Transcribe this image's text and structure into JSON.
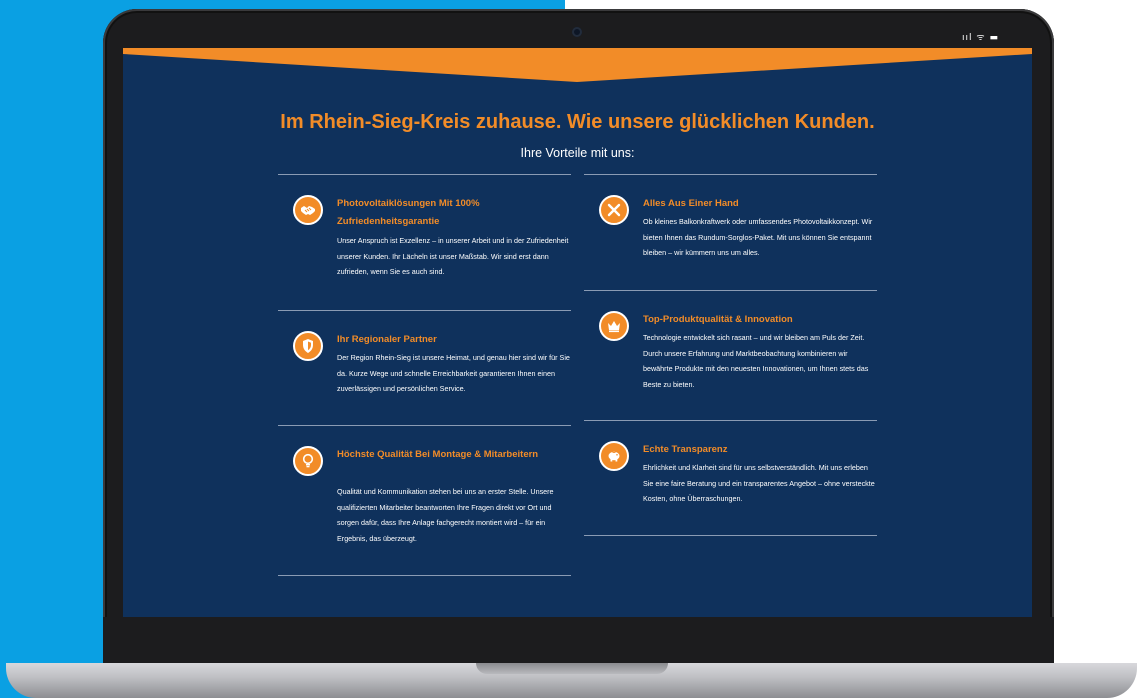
{
  "status_bar": {
    "indicators": "ııl ᯤ ▬"
  },
  "header": {
    "title": "Im Rhein-Sieg-Kreis zuhause. Wie unsere glücklichen Kunden.",
    "subtitle": "Ihre Vorteile mit uns:"
  },
  "colors": {
    "accent": "#f28c28",
    "background": "#0f315c",
    "text": "#ffffff"
  },
  "features_left": [
    {
      "icon": "handshake-icon",
      "title": "Photovoltaiklösungen Mit 100% Zufriedenheitsgarantie",
      "text": "Unser Anspruch ist Exzellenz – in unserer Arbeit und in der Zufriedenheit unserer Kunden. Ihr Lächeln ist unser Maßstab. Wir sind erst dann zufrieden, wenn Sie es auch sind."
    },
    {
      "icon": "shield-icon",
      "title": "Ihr Regionaler Partner",
      "text": "Der Region Rhein-Sieg ist unsere Heimat, und genau hier sind wir für Sie da. Kurze Wege und schnelle Erreichbarkeit garantieren Ihnen einen zuverlässigen und persönlichen Service."
    },
    {
      "icon": "lightbulb-icon",
      "title": "Höchste Qualität Bei Montage & Mitarbeitern",
      "text": "Qualität und Kommunikation stehen bei uns an erster Stelle. Unsere qualifizierten Mitarbeiter beantworten Ihre Fragen direkt vor Ort und sorgen dafür, dass Ihre Anlage fachgerecht montiert wird – für ein Ergebnis, das überzeugt."
    }
  ],
  "features_right": [
    {
      "icon": "tools-icon",
      "title": "Alles Aus Einer Hand",
      "text": "Ob kleines Balkonkraftwerk oder umfassendes Photovoltaikkonzept. Wir bieten Ihnen das Rundum-Sorglos-Paket. Mit uns können Sie entspannt bleiben – wir kümmern uns um alles."
    },
    {
      "icon": "crown-icon",
      "title": "Top-Produktqualität & Innovation",
      "text": "Technologie entwickelt sich rasant – und wir bleiben am Puls der Zeit. Durch unsere Erfahrung und Marktbeobachtung kombinieren wir bewährte Produkte mit den neuesten Innovationen, um Ihnen stets das Beste zu bieten."
    },
    {
      "icon": "piggy-bank-icon",
      "title": "Echte Transparenz",
      "text": "Ehrlichkeit und Klarheit sind für uns selbstverständlich. Mit uns erleben Sie eine faire Beratung und ein transparentes Angebot – ohne versteckte Kosten, ohne Überraschungen."
    }
  ]
}
